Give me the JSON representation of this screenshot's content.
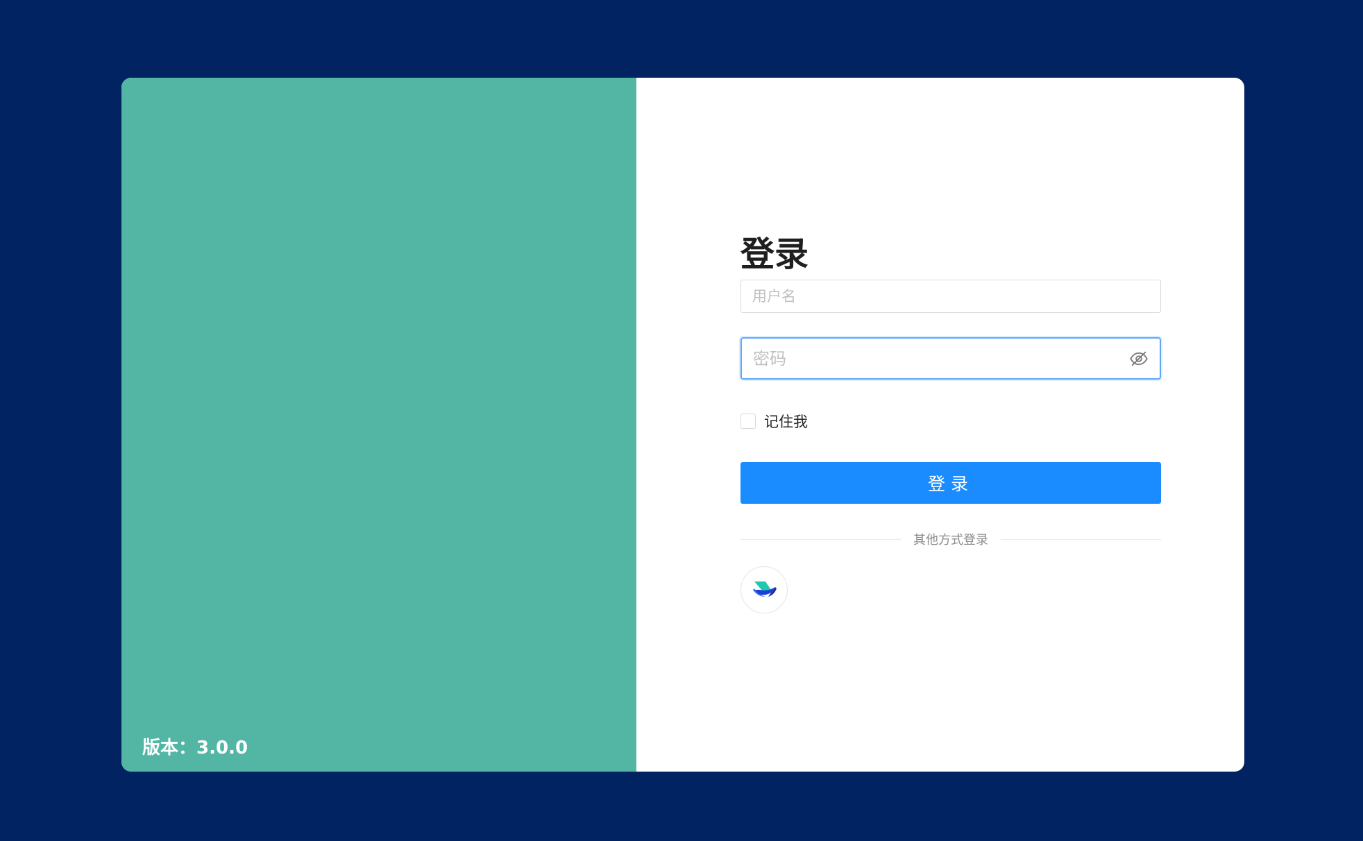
{
  "version": {
    "label": "版本：",
    "number": "3.0.0"
  },
  "login": {
    "title": "登录",
    "username_placeholder": "用户名",
    "password_placeholder": "密码",
    "remember_label": "记住我",
    "submit_label": "登录",
    "other_methods_label": "其他方式登录"
  },
  "icons": {
    "password_toggle": "eye-off-icon",
    "sso_provider": "feishu-logo-icon"
  },
  "colors": {
    "page_background": "#012362",
    "left_panel": "#53b6a4",
    "primary_button": "#1a8cff",
    "focus_border": "#62a7f5"
  }
}
